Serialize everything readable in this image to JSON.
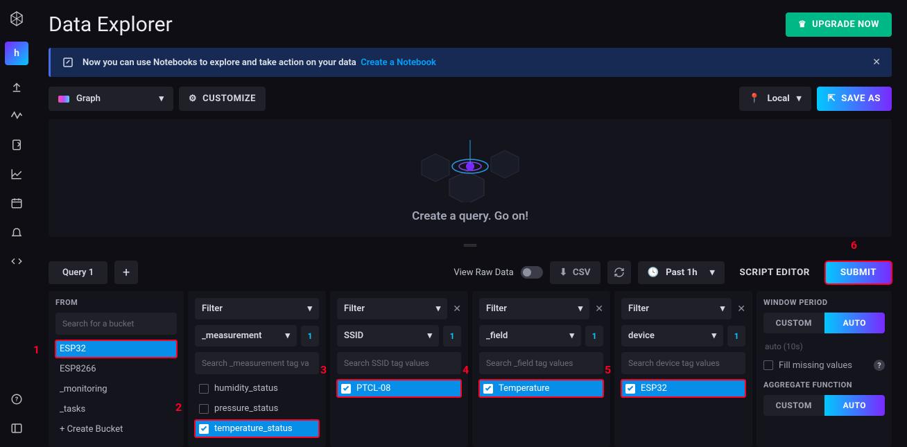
{
  "sidebar": {
    "workspace_letter": "h"
  },
  "header": {
    "title": "Data Explorer",
    "upgrade": "UPGRADE NOW"
  },
  "banner": {
    "text": "Now you can use Notebooks to explore and take action on your data",
    "link": "Create a Notebook"
  },
  "toolbar": {
    "graph": "Graph",
    "customize": "CUSTOMIZE",
    "local": "Local",
    "save_as": "SAVE AS"
  },
  "viz": {
    "prompt": "Create a query. Go on!"
  },
  "tabs": {
    "query1": "Query 1",
    "raw_label": "View Raw Data",
    "csv": "CSV",
    "time": "Past 1h",
    "script_editor": "SCRIPT EDITOR",
    "submit": "SUBMIT"
  },
  "from": {
    "label": "FROM",
    "placeholder": "Search for a bucket",
    "items": [
      "ESP32",
      "ESP8266",
      "_monitoring",
      "_tasks",
      "+ Create Bucket"
    ],
    "selected": "ESP32"
  },
  "filters": [
    {
      "label": "Filter",
      "tag": "_measurement",
      "count": "1",
      "placeholder": "Search _measurement tag va",
      "closable": false,
      "items": [
        {
          "label": "humidity_status",
          "checked": false
        },
        {
          "label": "pressure_status",
          "checked": false
        },
        {
          "label": "temperature_status",
          "checked": true
        }
      ]
    },
    {
      "label": "Filter",
      "tag": "SSID",
      "count": "1",
      "placeholder": "Search SSID tag values",
      "closable": true,
      "items": [
        {
          "label": "PTCL-08",
          "checked": true
        }
      ]
    },
    {
      "label": "Filter",
      "tag": "_field",
      "count": "1",
      "placeholder": "Search _field tag values",
      "closable": true,
      "items": [
        {
          "label": "Temperature",
          "checked": true
        }
      ]
    },
    {
      "label": "Filter",
      "tag": "device",
      "count": "1",
      "placeholder": "Search device tag values",
      "closable": true,
      "items": [
        {
          "label": "ESP32",
          "checked": true
        }
      ]
    }
  ],
  "window": {
    "label": "WINDOW PERIOD",
    "custom": "CUSTOM",
    "auto": "AUTO",
    "hint": "auto (10s)",
    "fill": "Fill missing values",
    "agg_label": "AGGREGATE FUNCTION"
  },
  "annotations": {
    "a1": "1",
    "a2": "2",
    "a3": "3",
    "a4": "4",
    "a5": "5",
    "a6": "6"
  }
}
